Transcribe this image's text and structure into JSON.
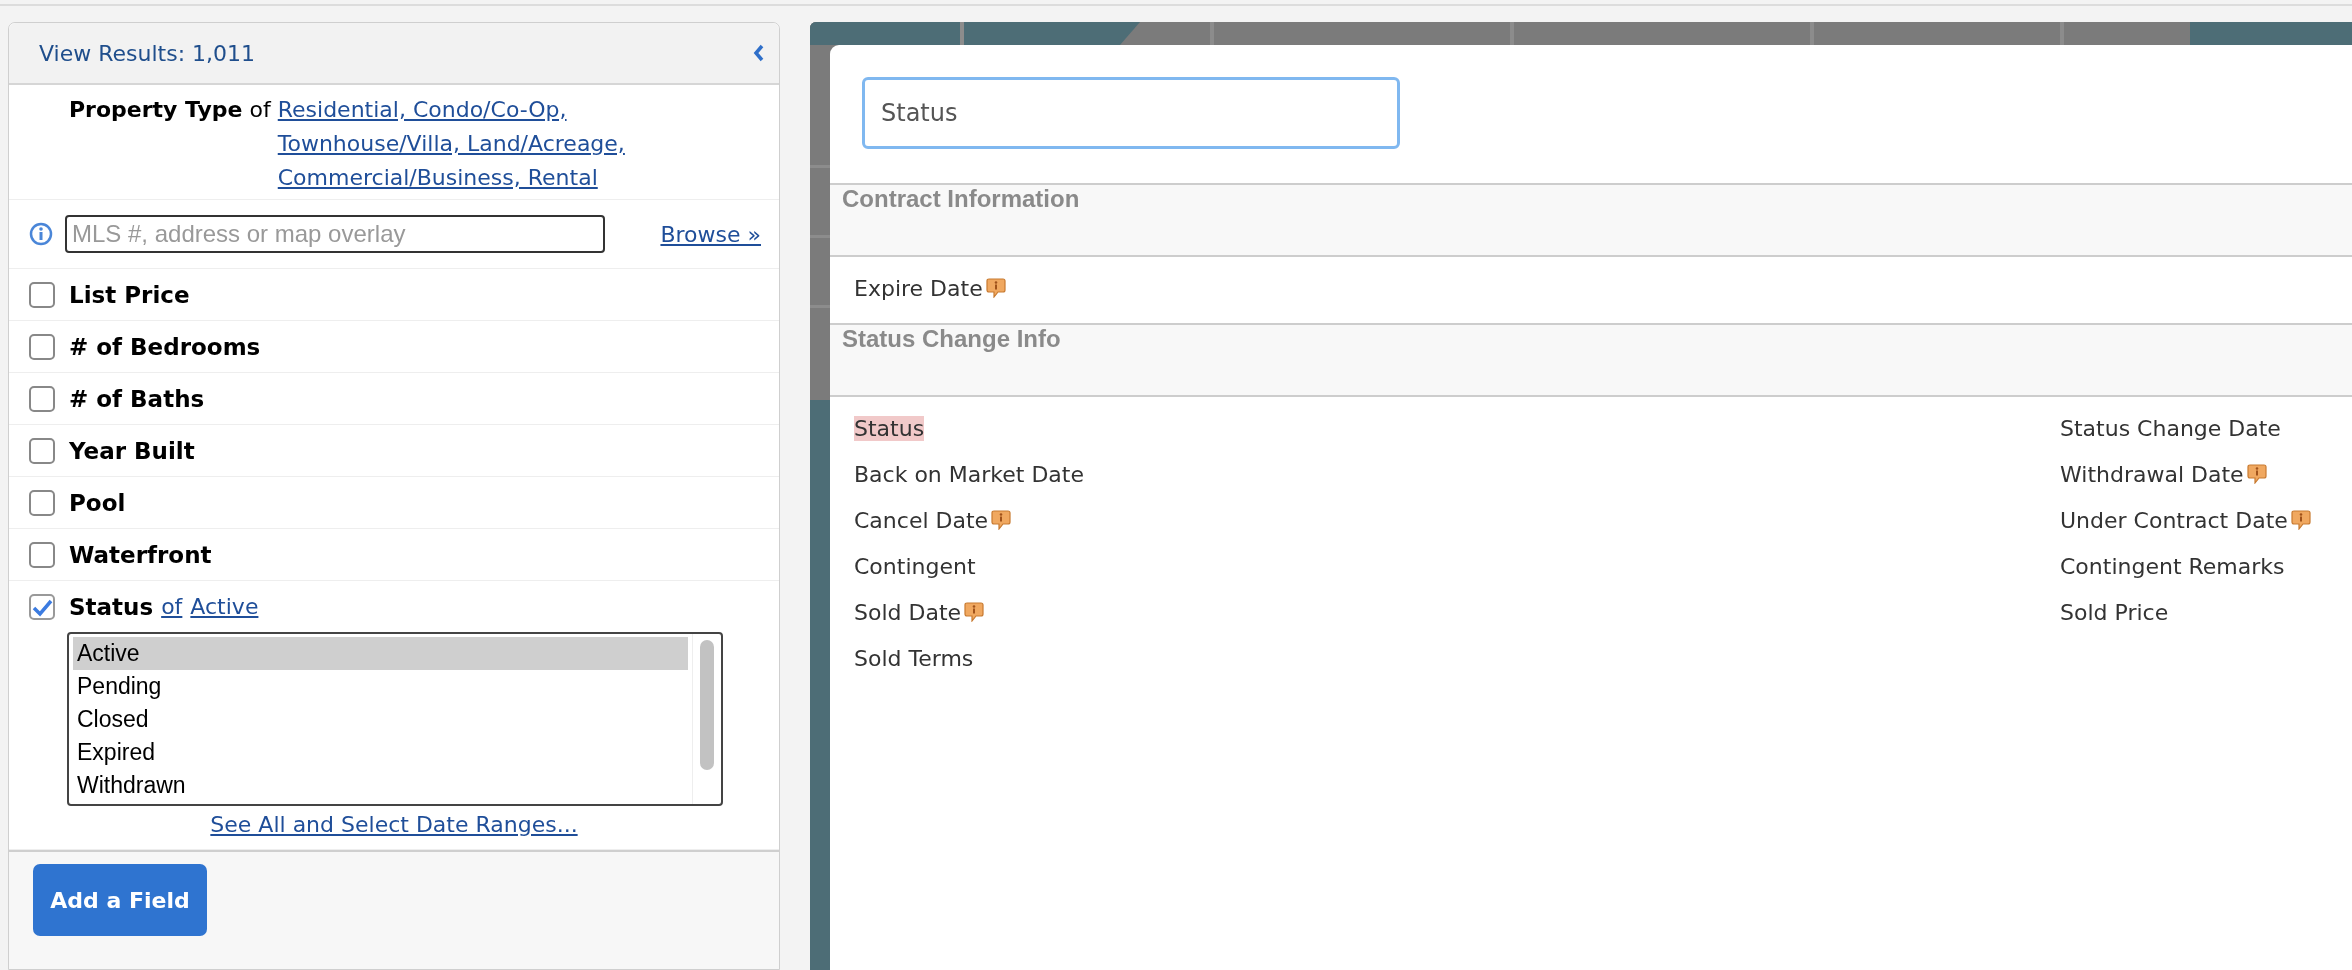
{
  "results_header": {
    "label": "View Results: 1,011"
  },
  "property_type": {
    "label": "Property Type",
    "connector": "of",
    "value": "Residential, Condo/Co-Op, Townhouse/Villa, Land/Acreage, Commercial/Business, Rental"
  },
  "search": {
    "placeholder": "MLS #, address or map overlay",
    "browse_link": "Browse »"
  },
  "fields": [
    {
      "label": "List Price",
      "checked": false
    },
    {
      "label": "# of Bedrooms",
      "checked": false
    },
    {
      "label": "# of Baths",
      "checked": false
    },
    {
      "label": "Year Built",
      "checked": false
    },
    {
      "label": "Pool",
      "checked": false
    },
    {
      "label": "Waterfront",
      "checked": false
    },
    {
      "label": "Status",
      "checked": true,
      "connector": "of",
      "value": "Active",
      "options": [
        {
          "label": "Active",
          "selected": true
        },
        {
          "label": "Pending",
          "selected": false
        },
        {
          "label": "Closed",
          "selected": false
        },
        {
          "label": "Expired",
          "selected": false
        },
        {
          "label": "Withdrawn",
          "selected": false
        }
      ],
      "more_link": "See All and Select Date Ranges..."
    }
  ],
  "add_button": "Add a Field",
  "field_picker": {
    "search_value": "Status",
    "sections": [
      {
        "title": "Contract Information",
        "columns": [
          {
            "items": [
              {
                "label": "Expire Date",
                "has_info": true,
                "selected": false
              }
            ]
          }
        ]
      },
      {
        "title": "Status Change Info",
        "columns": [
          {
            "items": [
              {
                "label": "Status",
                "has_info": false,
                "selected": true
              },
              {
                "label": "Back on Market Date",
                "has_info": false,
                "selected": false
              },
              {
                "label": "Cancel Date",
                "has_info": true,
                "selected": false
              },
              {
                "label": "Contingent",
                "has_info": false,
                "selected": false
              },
              {
                "label": "Sold Date",
                "has_info": true,
                "selected": false
              },
              {
                "label": "Sold Terms",
                "has_info": false,
                "selected": false
              }
            ]
          },
          {
            "items": [
              {
                "label": "Status Change Date",
                "has_info": false,
                "selected": false
              },
              {
                "label": "Withdrawal Date",
                "has_info": true,
                "selected": false
              },
              {
                "label": "Under Contract Date",
                "has_info": true,
                "selected": false
              },
              {
                "label": "Contingent Remarks",
                "has_info": false,
                "selected": false
              },
              {
                "label": "Sold Price",
                "has_info": false,
                "selected": false
              }
            ]
          }
        ]
      }
    ]
  }
}
